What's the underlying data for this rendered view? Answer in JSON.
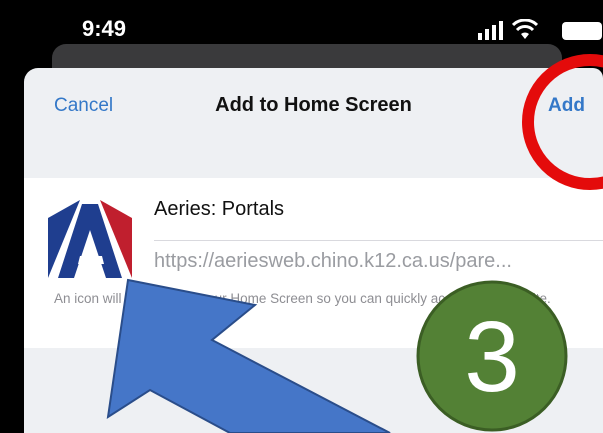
{
  "status": {
    "time": "9:49"
  },
  "header": {
    "cancel_label": "Cancel",
    "title": "Add to Home Screen",
    "add_label": "Add"
  },
  "bookmark": {
    "name": "Aeries: Portals",
    "url": "https://aeriesweb.chino.k12.ca.us/pare...",
    "icon": "aeries-app-icon",
    "icon_colors": {
      "left": "#1f3e8f",
      "right": "#c01f2e"
    }
  },
  "footnote": {
    "text": "An icon will be added to your Home Screen so you can quickly access this website."
  },
  "annotations": {
    "step_number": "3",
    "circle_color": "#e40b0b",
    "arrow_color": "#4576c8",
    "badge_color": "#538135"
  }
}
